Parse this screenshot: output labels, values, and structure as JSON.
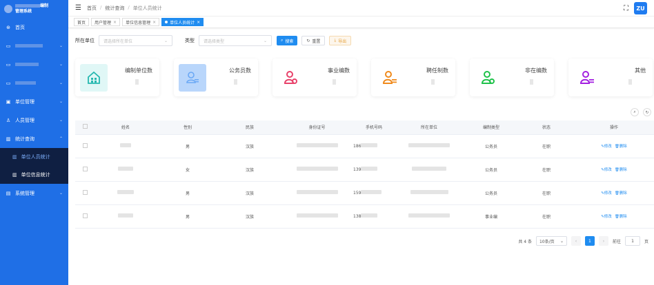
{
  "app": {
    "brand_line1": "编制",
    "brand_line2": "管理系统"
  },
  "sidebar": {
    "home": "首页",
    "unit_mgmt": "单位管理",
    "person_mgmt": "人员管理",
    "stats_query": "统计查询",
    "sub_unit_person": "单位人员统计",
    "sub_unit_info": "单位信息统计",
    "system_mgmt": "系统管理"
  },
  "breadcrumb": {
    "home": "首页",
    "sep": "/",
    "stats": "统计查询",
    "current": "单位人员统计"
  },
  "header": {
    "avatar_text": "ZU"
  },
  "tabs": [
    {
      "label": "首页"
    },
    {
      "label": "用户管理"
    },
    {
      "label": "单位信息管理"
    },
    {
      "label": "单位人员统计"
    }
  ],
  "filters": {
    "unit_label": "所在单位",
    "unit_placeholder": "请选择所在单位",
    "type_label": "类型",
    "type_placeholder": "请选择类型",
    "search": "搜索",
    "reset": "重置",
    "export": "导出"
  },
  "cards": [
    {
      "label": "编制单位数",
      "color": "#26b8b0",
      "bg": "#e0f7f6",
      "icon": "building-icon"
    },
    {
      "label": "公务员数",
      "color": "#6aa8f5",
      "bg": "#b9d6fb",
      "icon": "person-card-icon"
    },
    {
      "label": "事业编数",
      "color": "#e8416a",
      "bg": "#ffffff",
      "icon": "person-gear-icon"
    },
    {
      "label": "聘任制数",
      "color": "#f08a1c",
      "bg": "#ffffff",
      "icon": "person-list-icon"
    },
    {
      "label": "非在编数",
      "color": "#1fc24a",
      "bg": "#ffffff",
      "icon": "person-gear-icon"
    },
    {
      "label": "其他",
      "color": "#a31fe0",
      "bg": "#ffffff",
      "icon": "person-list-icon"
    }
  ],
  "table": {
    "headers": [
      "姓名",
      "性别",
      "民族",
      "身份证号",
      "手机号码",
      "所在单位",
      "编制类型",
      "状态",
      "操作"
    ],
    "rows": [
      {
        "gender": "男",
        "ethnicity": "汉族",
        "phone_prefix": "186",
        "type": "公务员",
        "status": "在职"
      },
      {
        "gender": "女",
        "ethnicity": "汉族",
        "phone_prefix": "139",
        "type": "公务员",
        "status": "在职"
      },
      {
        "gender": "男",
        "ethnicity": "汉族",
        "phone_prefix": "159",
        "type": "公务员",
        "status": "在职"
      },
      {
        "gender": "男",
        "ethnicity": "汉族",
        "phone_prefix": "138",
        "type": "事业编",
        "status": "在职"
      }
    ],
    "edit": "修改",
    "delete": "删除"
  },
  "pagination": {
    "total": "共 4 条",
    "page_size": "10条/页",
    "current": "1",
    "goto": "前往",
    "goto_value": "1",
    "page_suffix": "页"
  }
}
